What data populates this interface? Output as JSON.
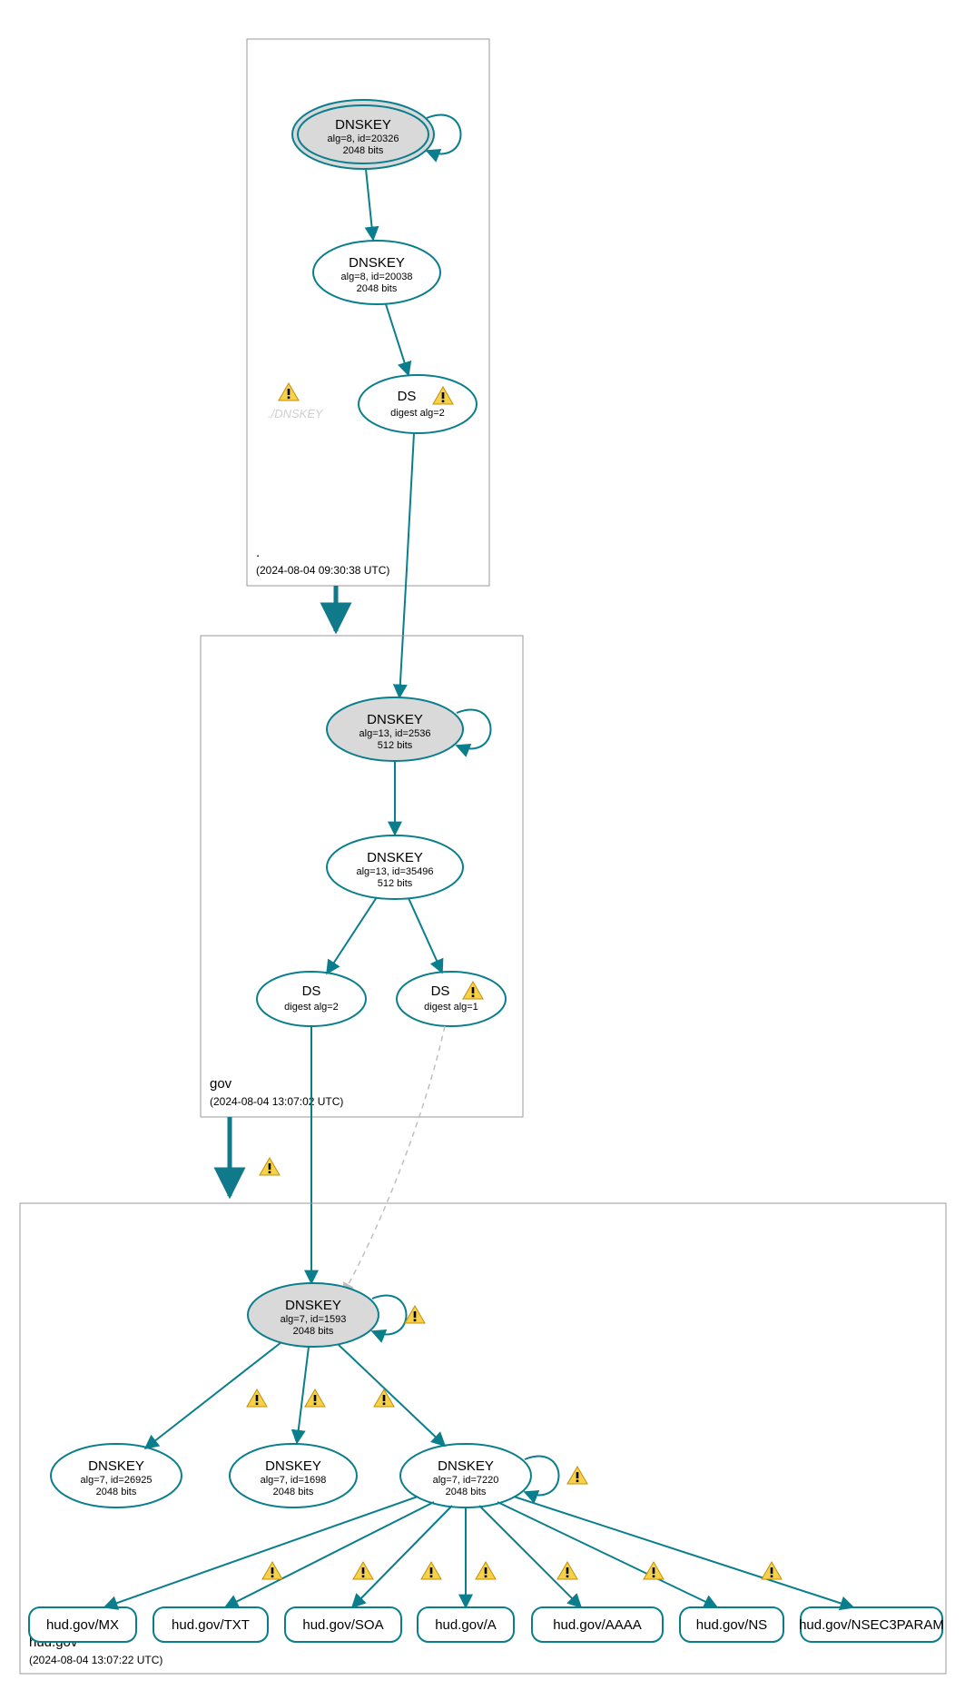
{
  "zones": {
    "root": {
      "label": ".",
      "time": "(2024-08-04 09:30:38 UTC)"
    },
    "gov": {
      "label": "gov",
      "time": "(2024-08-04 13:07:02 UTC)"
    },
    "hud": {
      "label": "hud.gov",
      "time": "(2024-08-04 13:07:22 UTC)"
    }
  },
  "nodes": {
    "root_ksk": {
      "title": "DNSKEY",
      "line1": "alg=8, id=20326",
      "line2": "2048 bits"
    },
    "root_zsk": {
      "title": "DNSKEY",
      "line1": "alg=8, id=20038",
      "line2": "2048 bits"
    },
    "root_ghost": {
      "title": "./DNSKEY"
    },
    "root_ds": {
      "title": "DS",
      "line1": "digest alg=2"
    },
    "gov_ksk": {
      "title": "DNSKEY",
      "line1": "alg=13, id=2536",
      "line2": "512 bits"
    },
    "gov_zsk": {
      "title": "DNSKEY",
      "line1": "alg=13, id=35496",
      "line2": "512 bits"
    },
    "gov_ds1": {
      "title": "DS",
      "line1": "digest alg=2"
    },
    "gov_ds2": {
      "title": "DS",
      "line1": "digest alg=1"
    },
    "hud_ksk": {
      "title": "DNSKEY",
      "line1": "alg=7, id=1593",
      "line2": "2048 bits"
    },
    "hud_k1": {
      "title": "DNSKEY",
      "line1": "alg=7, id=26925",
      "line2": "2048 bits"
    },
    "hud_k2": {
      "title": "DNSKEY",
      "line1": "alg=7, id=1698",
      "line2": "2048 bits"
    },
    "hud_k3": {
      "title": "DNSKEY",
      "line1": "alg=7, id=7220",
      "line2": "2048 bits"
    },
    "rr_mx": {
      "label": "hud.gov/MX"
    },
    "rr_txt": {
      "label": "hud.gov/TXT"
    },
    "rr_soa": {
      "label": "hud.gov/SOA"
    },
    "rr_a": {
      "label": "hud.gov/A"
    },
    "rr_aaaa": {
      "label": "hud.gov/AAAA"
    },
    "rr_ns": {
      "label": "hud.gov/NS"
    },
    "rr_nsec3": {
      "label": "hud.gov/NSEC3PARAM"
    }
  }
}
